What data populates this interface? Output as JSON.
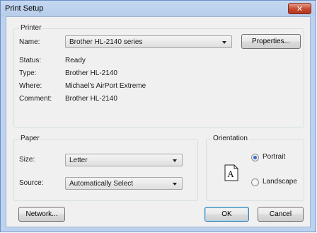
{
  "window": {
    "title": "Print Setup",
    "close_glyph": "✕"
  },
  "printer": {
    "group_title": "Printer",
    "name_label": "Name:",
    "name_value": "Brother HL-2140 series",
    "properties_button": "Properties...",
    "status_label": "Status:",
    "status_value": "Ready",
    "type_label": "Type:",
    "type_value": "Brother HL-2140",
    "where_label": "Where:",
    "where_value": "Michael's AirPort Extreme",
    "comment_label": "Comment:",
    "comment_value": "Brother HL-2140"
  },
  "paper": {
    "group_title": "Paper",
    "size_label": "Size:",
    "size_value": "Letter",
    "source_label": "Source:",
    "source_value": "Automatically Select"
  },
  "orientation": {
    "group_title": "Orientation",
    "page_icon_letter": "A",
    "portrait_label": "Portrait",
    "landscape_label": "Landscape",
    "selected": "Portrait"
  },
  "buttons": {
    "network": "Network...",
    "ok": "OK",
    "cancel": "Cancel"
  },
  "icons": {
    "close": "close-icon",
    "dropdown": "chevron-down-icon",
    "page": "page-orientation-icon"
  },
  "colors": {
    "titlebar": "#bcd2ee",
    "close_button": "#c7492f",
    "dialog_bg": "#f0f0f0"
  }
}
